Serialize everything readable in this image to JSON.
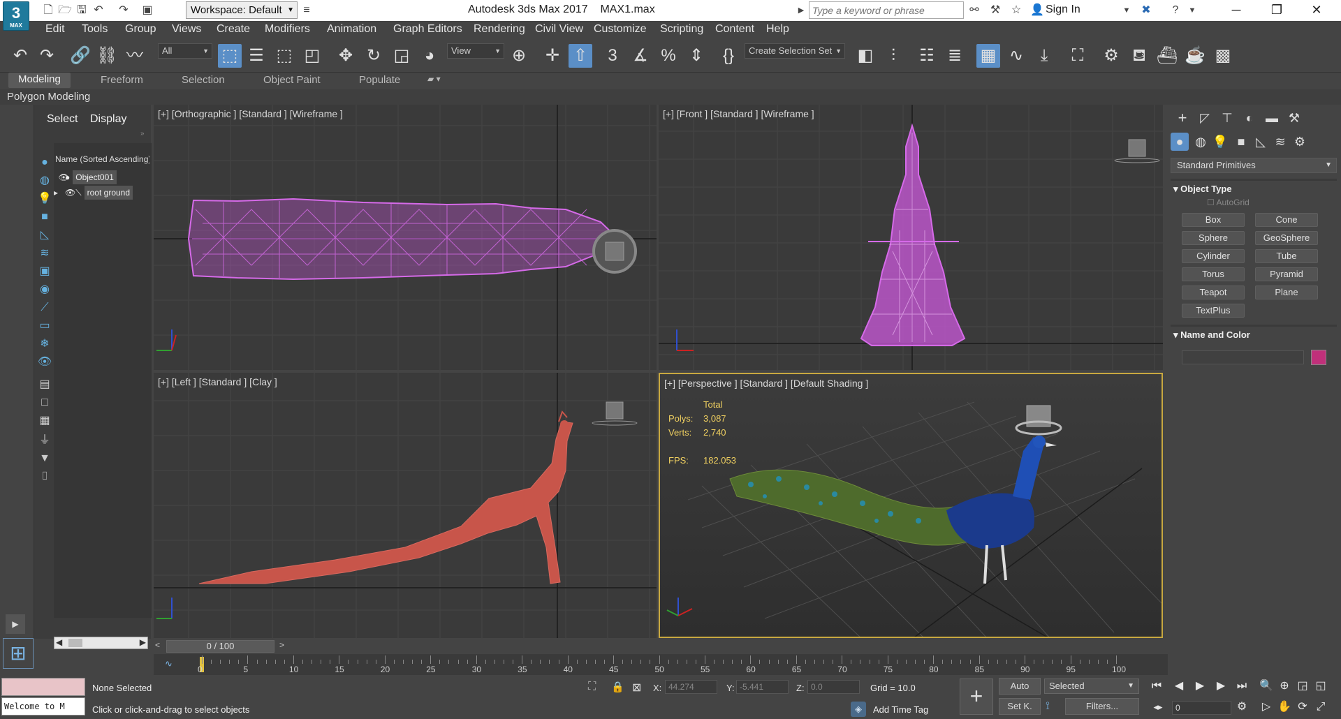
{
  "app": {
    "title": "Autodesk 3ds Max 2017",
    "file": "MAX1.max",
    "logo_text": "3",
    "logo_sub": "MAX",
    "workspace": "Workspace: Default",
    "search_placeholder": "Type a keyword or phrase",
    "sign_in": "Sign In"
  },
  "menu": [
    "Edit",
    "Tools",
    "Group",
    "Views",
    "Create",
    "Modifiers",
    "Animation",
    "Graph Editors",
    "Rendering",
    "Civil View",
    "Customize",
    "Scripting",
    "Content",
    "Help"
  ],
  "toolbar": {
    "selection_filter": "All",
    "ref_coord": "View",
    "selection_set": "Create Selection Set"
  },
  "ribbon": {
    "tabs": [
      "Modeling",
      "Freeform",
      "Selection",
      "Object Paint",
      "Populate"
    ],
    "active_tab": "Modeling",
    "subpanel": "Polygon Modeling"
  },
  "scene_explorer": {
    "tabs": [
      "Select",
      "Display"
    ],
    "column_header": "Name (Sorted Ascending)",
    "items": [
      {
        "name": "Object001"
      },
      {
        "name": "root ground"
      }
    ]
  },
  "viewports": {
    "top_left": "[+] [Orthographic ] [Standard ] [Wireframe ]",
    "top_right": "[+] [Front ] [Standard ] [Wireframe ]",
    "bottom_left": "[+] [Left ] [Standard ] [Clay ]",
    "bottom_right": "[+] [Perspective ] [Standard ] [Default Shading ]",
    "stats": {
      "total_label": "Total",
      "polys_label": "Polys:",
      "polys": "3,087",
      "verts_label": "Verts:",
      "verts": "2,740",
      "fps_label": "FPS:",
      "fps": "182.053"
    }
  },
  "command_panel": {
    "category": "Standard Primitives",
    "object_type_title": "Object Type",
    "autogrid": "AutoGrid",
    "buttons": [
      "Box",
      "Cone",
      "Sphere",
      "GeoSphere",
      "Cylinder",
      "Tube",
      "Torus",
      "Pyramid",
      "Teapot",
      "Plane",
      "TextPlus"
    ],
    "name_color_title": "Name and Color",
    "object_color": "#c0307a"
  },
  "timeline": {
    "slider": "0 / 100",
    "ticks": [
      "0",
      "5",
      "10",
      "15",
      "20",
      "25",
      "30",
      "35",
      "40",
      "45",
      "50",
      "55",
      "60",
      "65",
      "70",
      "75",
      "80",
      "85",
      "90",
      "95",
      "100"
    ]
  },
  "status": {
    "maxscript": "Welcome to M",
    "selection": "None Selected",
    "prompt": "Click or click-and-drag to select objects",
    "x_label": "X:",
    "x": "44.274",
    "y_label": "Y:",
    "y": "-5.441",
    "z_label": "Z:",
    "z": "0.0",
    "grid": "Grid = 10.0",
    "add_time_tag": "Add Time Tag",
    "auto": "Auto",
    "set_key": "Set K.",
    "selected": "Selected",
    "filters": "Filters...",
    "frame": "0"
  }
}
